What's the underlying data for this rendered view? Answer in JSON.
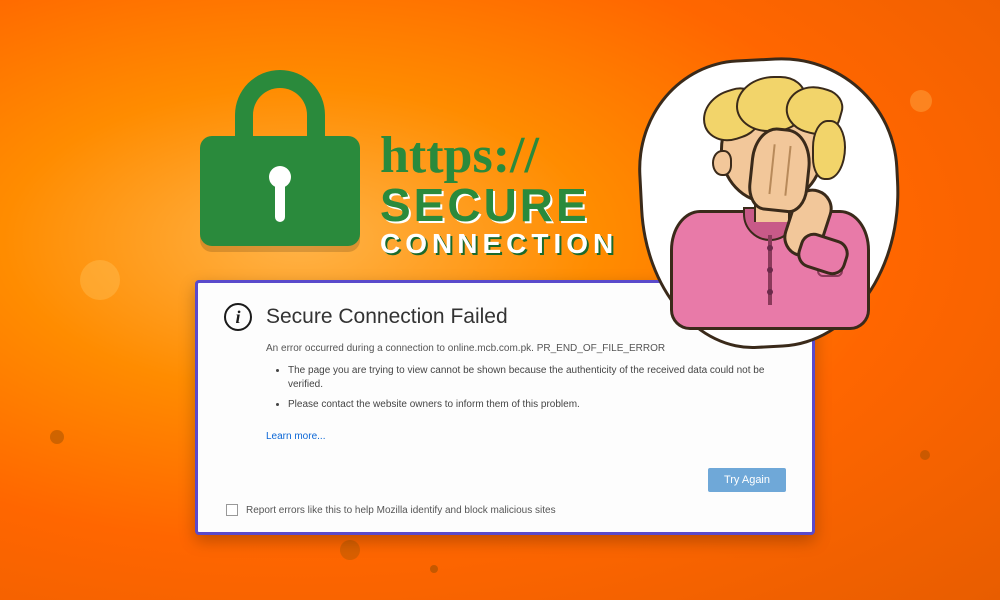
{
  "decorative": {
    "https_line1": "https://",
    "https_line2": "SECURE",
    "https_line3": "CONNECTION"
  },
  "dialog": {
    "title": "Secure Connection Failed",
    "subtitle": "An error occurred during a connection to online.mcb.com.pk. PR_END_OF_FILE_ERROR",
    "bullets": [
      "The page you are trying to view cannot be shown because the authenticity of the received data could not be verified.",
      "Please contact the website owners to inform them of this problem."
    ],
    "learn_more": "Learn more...",
    "try_again": "Try Again",
    "report_label": "Report errors like this to help Mozilla identify and block malicious sites"
  },
  "colors": {
    "accent_green": "#2a8a3c",
    "dialog_border": "#5a4acb",
    "button_blue": "#6fa8d8",
    "link_blue": "#0a66d6",
    "shirt_pink": "#e87aa8",
    "hair_blonde": "#f2d46a",
    "bg_orange": "#ff7700"
  }
}
